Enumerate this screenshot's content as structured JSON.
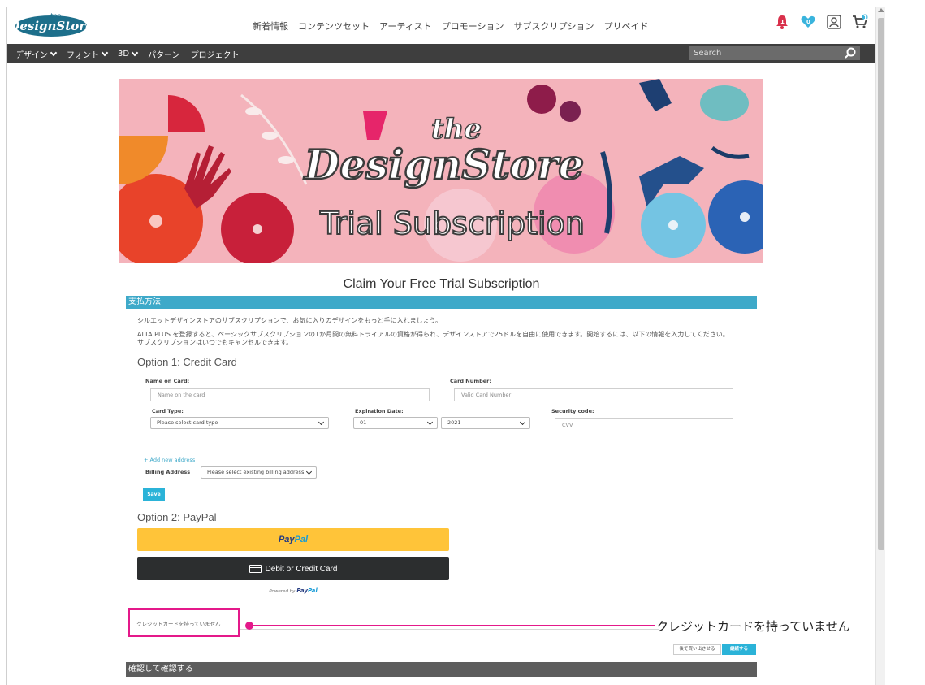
{
  "header": {
    "nav": [
      "新着情報",
      "コンテンツセット",
      "アーティスト",
      "プロモーション",
      "サブスクリプション",
      "プリペイド"
    ],
    "icons": [
      {
        "name": "bell-icon",
        "badge": "1",
        "color": "#d9304b"
      },
      {
        "name": "heart-icon",
        "badge": "0",
        "color": "#3ab4dd"
      },
      {
        "name": "account-icon",
        "badge": "",
        "color": "#555555"
      },
      {
        "name": "cart-icon",
        "badge": "1",
        "color": "#444444"
      }
    ]
  },
  "category_bar": {
    "items": [
      {
        "label": "デザイン",
        "dropdown": true
      },
      {
        "label": "フォント",
        "dropdown": true
      },
      {
        "label": "3D",
        "dropdown": true
      },
      {
        "label": "パターン",
        "dropdown": false
      },
      {
        "label": "プロジェクト",
        "dropdown": false
      }
    ],
    "search_placeholder": "Search"
  },
  "hero": {
    "the": "the",
    "brand": "DesignStore",
    "subtitle": "Trial Subscription"
  },
  "page_title": "Claim Your Free Trial Subscription",
  "payment_section": {
    "heading": "支払方法",
    "intro1": "シルエットデザインストアのサブスクリプションで、お気に入りのデザインをもっと手に入れましょう。",
    "intro2": "ALTA PLUS を登録すると、ベーシックサブスクリプションの1か月間の無料トライアルの資格が得られ、デザインストアで25ドルを自由に使用できます。開始するには、以下の情報を入力してください。",
    "intro3": "サブスクリプションはいつでもキャンセルできます。"
  },
  "option1": {
    "heading": "Option 1: Credit Card",
    "name_label": "Name on Card:",
    "name_placeholder": "Name on the card",
    "number_label": "Card Number:",
    "number_placeholder": "Valid Card Number",
    "type_label": "Card Type:",
    "type_value": "Please select card type",
    "exp_label": "Expiration Date:",
    "exp_month": "01",
    "exp_year": "2021",
    "cvv_label": "Security code:",
    "cvv_placeholder": "CVV",
    "add_address": "+ Add new address",
    "billing_label": "Billing Address",
    "billing_value": "Please select existing billing address",
    "save": "Save"
  },
  "option2": {
    "heading": "Option 2: PayPal",
    "paypal_a": "Pay",
    "paypal_b": "Pal",
    "card_button": "Debit or Credit Card",
    "powered_by": "Powered by",
    "powered_a": "Pay",
    "powered_b": "Pal"
  },
  "no_card": {
    "label": "クレジットカードを持っていません",
    "callout": "クレジットカードを持っていません",
    "accent": "#e4198a"
  },
  "actions": {
    "later": "後で買い出させる",
    "continue": "継続する"
  },
  "confirm_heading": "確認して確認する"
}
